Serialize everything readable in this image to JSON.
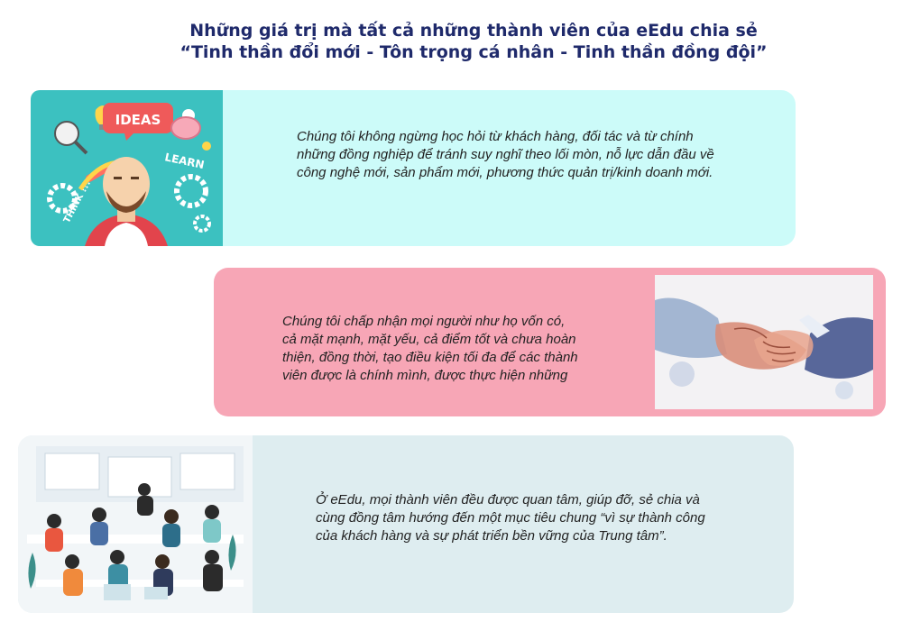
{
  "header": {
    "line1": "Những giá trị mà tất cả những thành viên của eEdu chia sẻ",
    "line2": "“Tinh thần đổi mới -  Tôn trọng cá nhân - Tinh thần đồng đội”"
  },
  "values": [
    {
      "lines": [
        "Chúng tôi không ngừng học hỏi từ khách hàng, đối tác và từ chính",
        "những đồng nghiệp để tránh suy nghĩ theo lối mòn, nỗ lực dẫn đầu về",
        "công nghệ mới, sản phẩm mới, phương thức quản trị/kinh doanh mới."
      ],
      "image_words": [
        "IDEAS",
        "LEARN",
        "THINK !!!"
      ],
      "color": "#ccfbf9"
    },
    {
      "lines": [
        "Chúng tôi chấp nhận mọi người như họ vốn có,",
        "cả mặt mạnh, mặt yếu, cả điểm tốt và chưa hoàn",
        "thiện, đồng thời, tạo điều kiện tối đa để các thành",
        "viên được là chính mình, được thực hiện những"
      ],
      "color": "#f7a6b6"
    },
    {
      "lines": [
        "Ở eEdu, mọi thành viên đều được quan tâm, giúp đỡ, sẻ chia và",
        "cùng đồng tâm hướng đến một mục tiêu chung “vì sự thành công",
        "của khách hàng và sự phát triển bền vững của Trung tâm”."
      ],
      "color": "#deedf0"
    }
  ]
}
